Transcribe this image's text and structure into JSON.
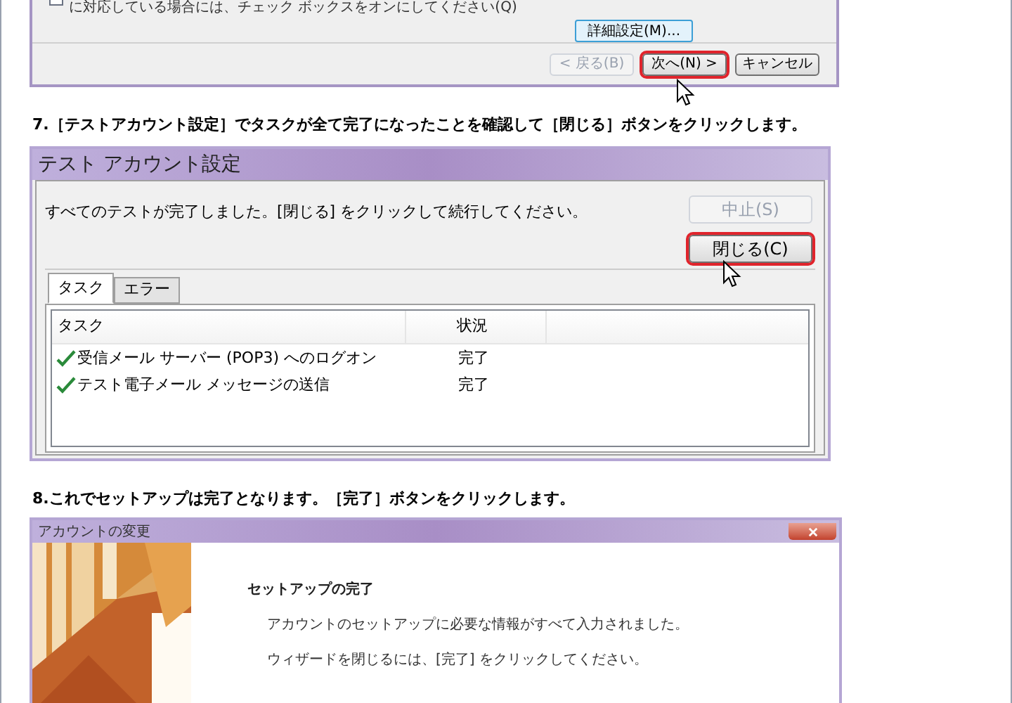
{
  "wizard_top": {
    "checkbox": {
      "checked": false
    },
    "note": "に対応している場合には、チェック ボックスをオンにしてください(Q)",
    "advanced_button": {
      "label": "詳細設定(M)...",
      "disabled": false,
      "highlighted": false
    },
    "buttons": [
      {
        "label": "< 戻る(B)",
        "disabled": true,
        "highlighted": false
      },
      {
        "label": "次へ(N) >",
        "disabled": false,
        "highlighted": true
      },
      {
        "label": "キャンセル",
        "disabled": false,
        "highlighted": false
      }
    ]
  },
  "step_7": {
    "instruction": "7.［テストアカウント設定］でタスクが全て完了になったことを確認して［閉じる］ボタンをクリックします。",
    "dialog": {
      "title": "テスト アカウント設定",
      "message": "すべてのテストが完了しました。[閉じる] をクリックして続行してください。",
      "buttons": [
        {
          "label": "中止(S)",
          "disabled": true,
          "highlighted": false
        },
        {
          "label": "閉じる(C)",
          "disabled": false,
          "highlighted": true
        }
      ],
      "tabs": [
        {
          "label": "タスク",
          "selected": true
        },
        {
          "label": "エラー",
          "selected": false
        }
      ],
      "columns": [
        "タスク",
        "状況"
      ],
      "rows": [
        {
          "task": "受信メール サーバー (POP3) へのログオン",
          "status": "完了",
          "done": true
        },
        {
          "task": "テスト電子メール メッセージの送信",
          "status": "完了",
          "done": true
        }
      ]
    }
  },
  "step_8": {
    "instruction": "8.これでセットアップは完了となります。［完了］ボタンをクリックします。",
    "dialog": {
      "title": "アカウントの変更",
      "heading": "セットアップの完了",
      "lines": [
        "アカウントのセットアップに必要な情報がすべて入力されました。",
        "ウィザードを閉じるには、[完了] をクリックしてください。"
      ]
    }
  }
}
